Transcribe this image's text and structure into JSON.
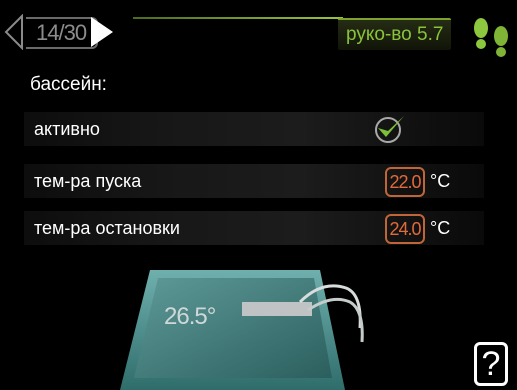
{
  "header": {
    "page_counter": "14/30",
    "menu_label": "руко-во 5.7",
    "prev_icon": "arrow-left-outline-icon",
    "next_icon": "arrow-right-filled-icon",
    "help_icon": "footprints-icon",
    "accent_color": "#89c33a"
  },
  "section": {
    "title": "бассейн:"
  },
  "settings": [
    {
      "label": "активно",
      "type": "checkbox",
      "checked": true
    },
    {
      "label": "тем-ра пуска",
      "type": "number",
      "value": "22.0",
      "unit": "°C"
    },
    {
      "label": "тем-ра остановки",
      "type": "number",
      "value": "24.0",
      "unit": "°C"
    }
  ],
  "pool": {
    "temperature": "26.5°",
    "icon": "pool-icon"
  },
  "footer": {
    "help_label": "?",
    "help_icon": "question-mark-icon"
  },
  "colors": {
    "value_border": "#c06538",
    "value_text": "#e06a3c",
    "checkmark": "#7cc03a"
  }
}
